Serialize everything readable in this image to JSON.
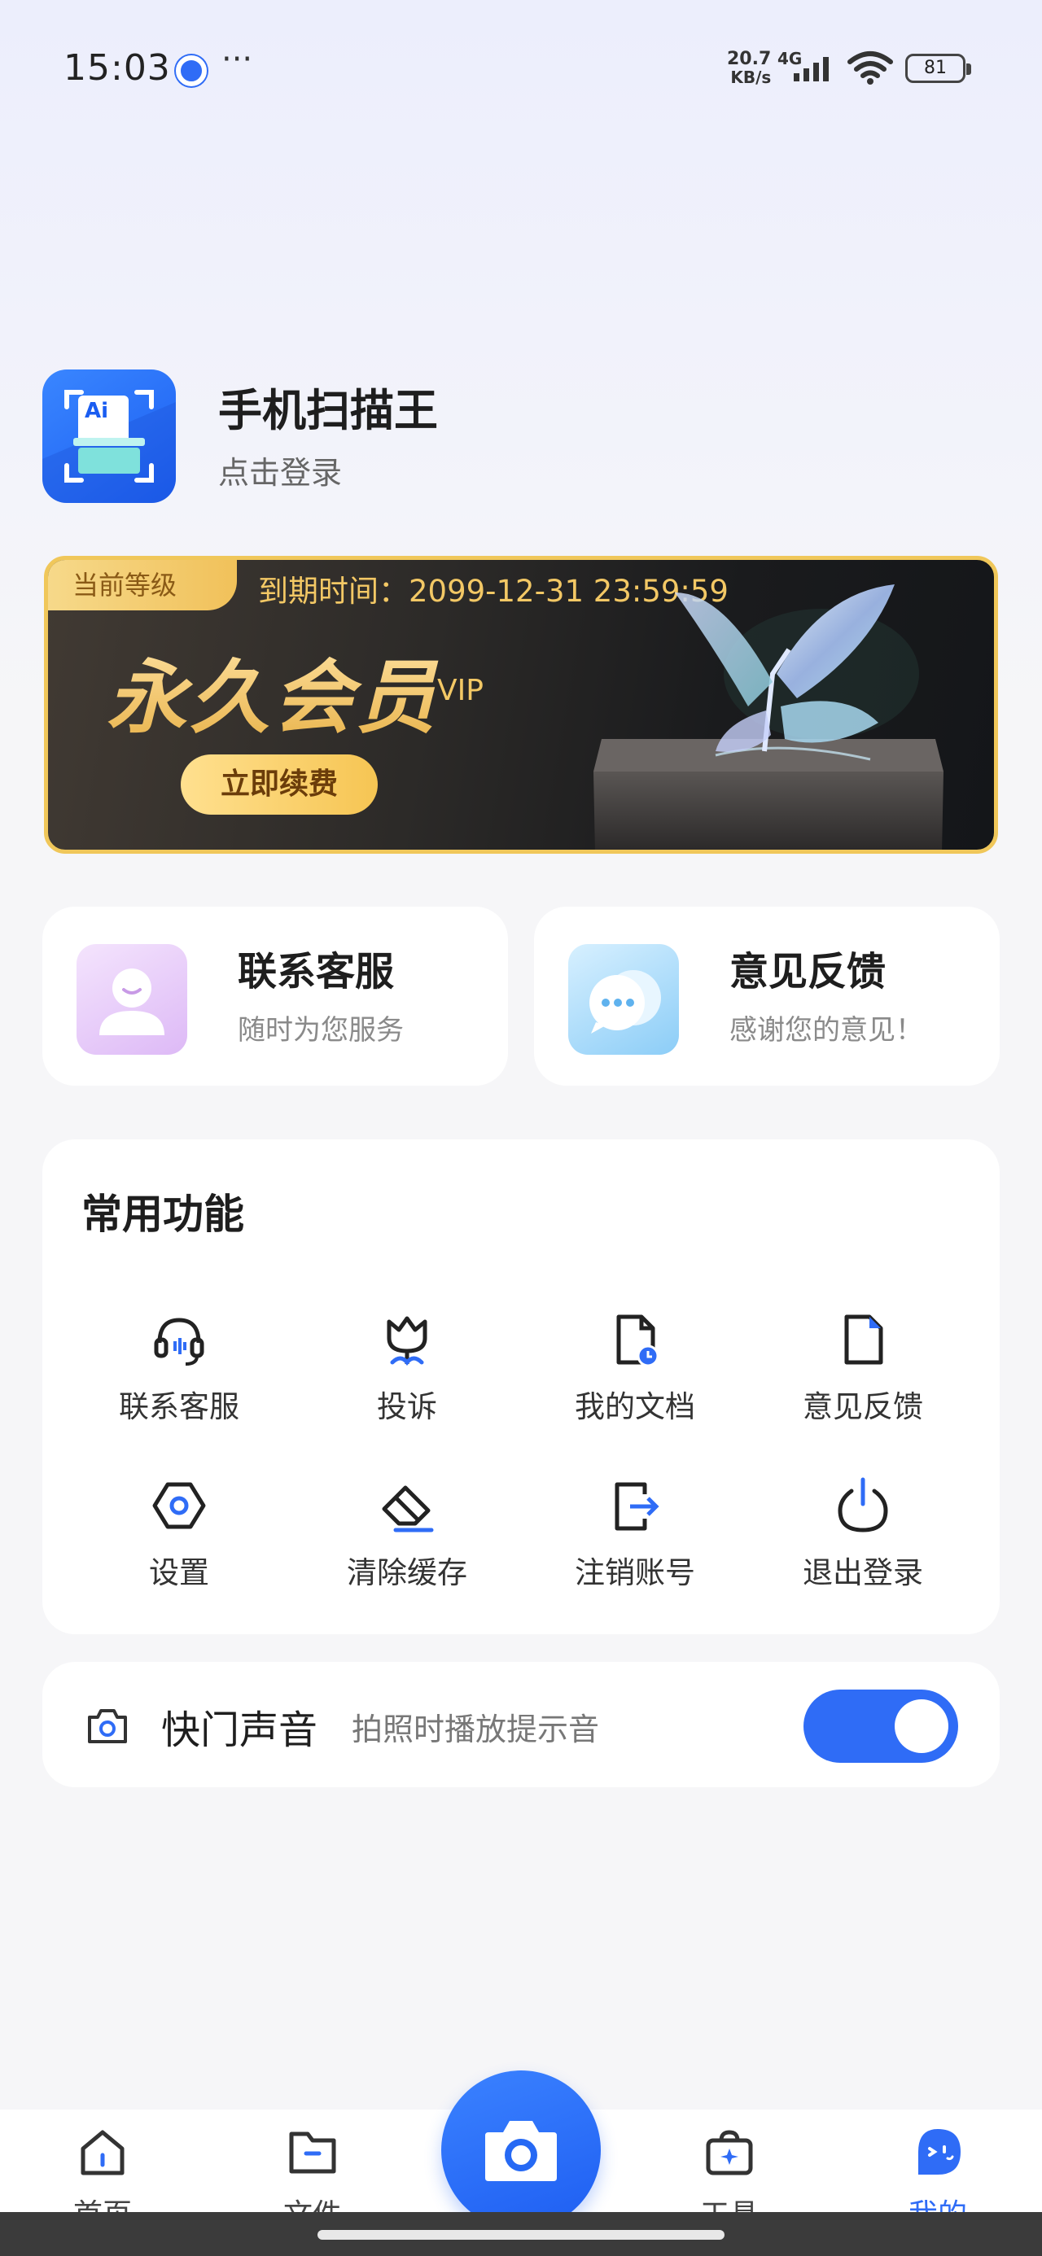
{
  "status_bar": {
    "time": "15:03",
    "net_speed_value": "20.7",
    "net_speed_unit": "KB/s",
    "network_type": "4G",
    "battery": "81"
  },
  "profile": {
    "app_name": "手机扫描王",
    "login_text": "点击登录",
    "logo_text": "Ai"
  },
  "vip": {
    "level_tag": "当前等级",
    "expire_text": "到期时间：2099-12-31 23:59:59",
    "title": "永久会员",
    "badge": "VIP",
    "renew_label": "立即续费"
  },
  "quick_cards": [
    {
      "title": "联系客服",
      "subtitle": "随时为您服务",
      "icon": "customer-service-icon",
      "color": "#d9b7f5"
    },
    {
      "title": "意见反馈",
      "subtitle": "感谢您的意见！",
      "icon": "feedback-chat-icon",
      "color": "#8fcff8"
    }
  ],
  "features": {
    "title": "常用功能",
    "items": [
      {
        "label": "联系客服",
        "icon": "headset-icon"
      },
      {
        "label": "投诉",
        "icon": "tulip-icon"
      },
      {
        "label": "我的文档",
        "icon": "document-clock-icon"
      },
      {
        "label": "意见反馈",
        "icon": "document-icon"
      },
      {
        "label": "设置",
        "icon": "hexagon-settings-icon"
      },
      {
        "label": "清除缓存",
        "icon": "eraser-icon"
      },
      {
        "label": "注销账号",
        "icon": "logout-box-icon"
      },
      {
        "label": "退出登录",
        "icon": "power-icon"
      }
    ]
  },
  "shutter": {
    "title": "快门声音",
    "subtitle": "拍照时播放提示音",
    "enabled": true
  },
  "tabbar": {
    "tabs": [
      {
        "label": "首页",
        "icon": "home-icon"
      },
      {
        "label": "文件",
        "icon": "folder-icon"
      },
      {
        "label": "工具",
        "icon": "toolbox-icon"
      },
      {
        "label": "我的",
        "icon": "profile-face-icon"
      }
    ],
    "active_index": 3,
    "camera_icon": "camera-icon"
  },
  "colors": {
    "accent": "#2f6cf6",
    "vip_gold": "#f3c865"
  }
}
